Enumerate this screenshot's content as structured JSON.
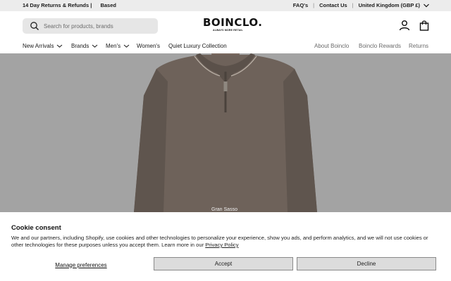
{
  "topbar": {
    "promo_left": "14 Day Returns & Refunds |",
    "promo_right": "Based",
    "faqs": "FAQ's",
    "contact": "Contact Us",
    "region": "United Kingdom (GBP £)"
  },
  "header": {
    "search_placeholder": "Search for products, brands",
    "logo_text": "BOINCLO.",
    "logo_tagline": "ALWAYS MORE RETAIL"
  },
  "nav": {
    "left": [
      "New Arrivals",
      "Brands",
      "Men's",
      "Women's",
      "Quiet Luxury Collection"
    ],
    "right": [
      "About Boinclo",
      "Boinclo Rewards",
      "Returns"
    ]
  },
  "hero": {
    "caption": "Gran Sasso",
    "product_color": "#6e625a"
  },
  "cookie": {
    "title": "Cookie consent",
    "body": "We and our partners, including Shopify, use cookies and other technologies to personalize your experience, show you ads, and perform analytics, and we will not use cookies or other technologies for these purposes unless you accept them. Learn more in our ",
    "policy_link": "Privacy Policy",
    "manage": "Manage preferences",
    "accept": "Accept",
    "decline": "Decline"
  }
}
